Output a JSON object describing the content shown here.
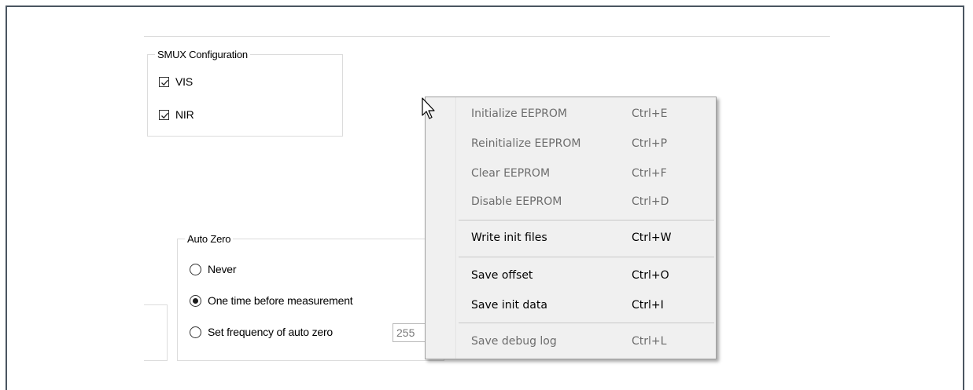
{
  "smux": {
    "title": "SMUX Configuration",
    "options": [
      {
        "label": "VIS",
        "checked": true
      },
      {
        "label": "NIR",
        "checked": true
      }
    ]
  },
  "auto_zero": {
    "title": "Auto Zero",
    "options": [
      {
        "label": "Never",
        "selected": false
      },
      {
        "label": "One time before measurement",
        "selected": true
      },
      {
        "label": "Set frequency of auto zero",
        "selected": false
      }
    ],
    "frequency_value": "255"
  },
  "context_menu": {
    "items": [
      {
        "label": "Initialize EEPROM",
        "shortcut": "Ctrl+E",
        "enabled": false
      },
      {
        "label": "Reinitialize EEPROM",
        "shortcut": "Ctrl+P",
        "enabled": false
      },
      {
        "label": "Clear EEPROM",
        "shortcut": "Ctrl+F",
        "enabled": false
      },
      {
        "label": "Disable EEPROM",
        "shortcut": "Ctrl+D",
        "enabled": false
      },
      {
        "label": "Write init files",
        "shortcut": "Ctrl+W",
        "enabled": true
      },
      {
        "label": "Save offset",
        "shortcut": "Ctrl+O",
        "enabled": true
      },
      {
        "label": "Save init data",
        "shortcut": "Ctrl+I",
        "enabled": true
      },
      {
        "label": "Save debug log",
        "shortcut": "Ctrl+L",
        "enabled": false
      }
    ]
  },
  "icons": {
    "cursor": "mouse-pointer-icon",
    "check": "check-icon"
  }
}
